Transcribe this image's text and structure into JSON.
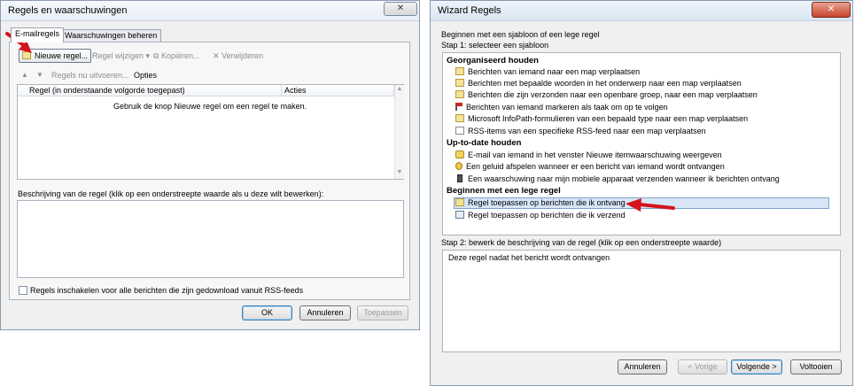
{
  "left_window": {
    "title": "Regels en waarschuwingen",
    "close": "✕",
    "tabs": [
      {
        "label": "E-mailregels"
      },
      {
        "label": "Waarschuwingen beheren"
      }
    ],
    "toolbar": {
      "new_rule": "Nieuwe regel...",
      "change_rule": "Regel wijzigen",
      "copy": "Kopiëren...",
      "delete": "Verwijderen",
      "run_rules": "Regels nu uitvoeren...",
      "options": "Opties"
    },
    "table": {
      "col_rule": "Regel (in onderstaande volgorde toegepast)",
      "col_actions": "Acties",
      "empty_text": "Gebruik de knop Nieuwe regel om een regel te maken."
    },
    "description_label": "Beschrijving van de regel (klik op een onderstreepte waarde als u deze wilt bewerken):",
    "rss_checkbox": "Regels inschakelen voor alle berichten die zijn gedownload vanuit RSS-feeds",
    "buttons": {
      "ok": "OK",
      "cancel": "Annuleren",
      "apply": "Toepassen"
    }
  },
  "right_window": {
    "title": "Wizard Regels",
    "close": "✕",
    "intro": "Beginnen met een sjabloon of een lege regel",
    "step1": "Stap 1: selecteer een sjabloon",
    "groups": [
      {
        "title": "Georganiseerd houden",
        "items": [
          {
            "icon": "envelope-icon",
            "label": "Berichten van iemand naar een map verplaatsen"
          },
          {
            "icon": "envelope-icon",
            "label": "Berichten met bepaalde woorden in het onderwerp naar een map verplaatsen"
          },
          {
            "icon": "envelope-icon",
            "label": "Berichten die zijn verzonden naar een openbare groep, naar een map verplaatsen"
          },
          {
            "icon": "flag-icon",
            "label": "Berichten van iemand markeren als taak om op te volgen"
          },
          {
            "icon": "envelope-icon",
            "label": "Microsoft InfoPath-formulieren van een bepaald type naar een map verplaatsen"
          },
          {
            "icon": "document-icon",
            "label": "RSS-items van een specifieke RSS-feed naar een map verplaatsen"
          }
        ]
      },
      {
        "title": "Up-to-date houden",
        "items": [
          {
            "icon": "star-icon",
            "label": "E-mail van iemand in het venster Nieuwe itemwaarschuwing weergeven"
          },
          {
            "icon": "sound-icon",
            "label": "Een geluid afspelen wanneer er een bericht van iemand wordt ontvangen"
          },
          {
            "icon": "phone-icon",
            "label": "Een waarschuwing naar mijn mobiele apparaat verzenden wanneer ik berichten ontvang"
          }
        ]
      },
      {
        "title": "Beginnen met een lege regel",
        "items": [
          {
            "icon": "envelope-icon",
            "label": "Regel toepassen op berichten die ik ontvang",
            "selected": true
          },
          {
            "icon": "send-icon",
            "label": "Regel toepassen op berichten die ik verzend"
          }
        ]
      }
    ],
    "step2": "Stap 2: bewerk de beschrijving van de regel (klik op een onderstreepte waarde)",
    "description_text": "Deze regel nadat het bericht wordt ontvangen",
    "buttons": {
      "cancel": "Annuleren",
      "back": "< Vorige",
      "next": "Volgende >",
      "finish": "Voltooien"
    }
  },
  "colors": {
    "arrow": "#d4141b",
    "selection": "#d6e6f7"
  }
}
